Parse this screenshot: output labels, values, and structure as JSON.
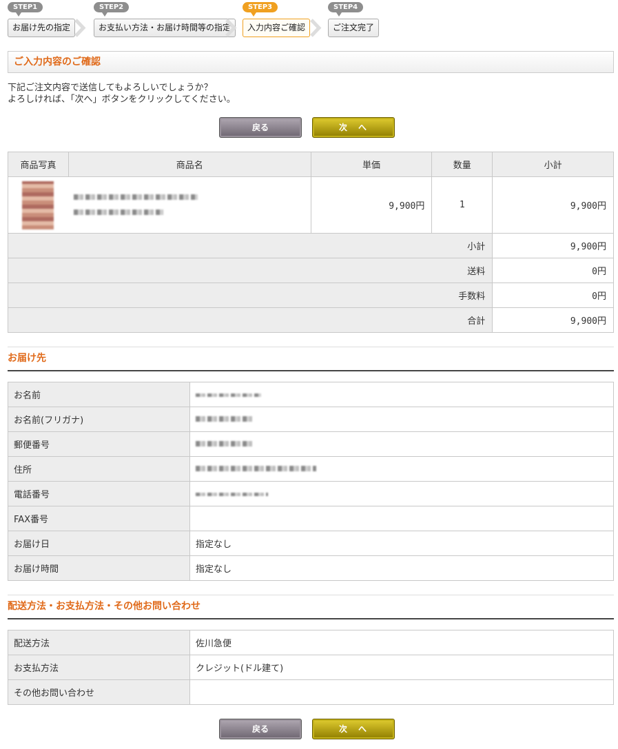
{
  "steps": [
    {
      "badge": "STEP1",
      "label": "お届け先の指定"
    },
    {
      "badge": "STEP2",
      "label": "お支払い方法・お届け時間等の指定"
    },
    {
      "badge": "STEP3",
      "label": "入力内容ご確認"
    },
    {
      "badge": "STEP4",
      "label": "ご注文完了"
    }
  ],
  "section_title": "ご入力内容のご確認",
  "intro": {
    "line1": "下記ご注文内容で送信してもよろしいでしょうか？",
    "line2": "よろしければ、「次へ」ボタンをクリックしてください。"
  },
  "buttons": {
    "back": "戻る",
    "next": "次　へ"
  },
  "order_table": {
    "headers": [
      "商品写真",
      "商品名",
      "単価",
      "数量",
      "小計"
    ],
    "item": {
      "unit_price": "9,900円",
      "quantity": "1",
      "subtotal": "9,900円"
    },
    "summary": [
      {
        "label": "小計",
        "value": "9,900円"
      },
      {
        "label": "送料",
        "value": "0円"
      },
      {
        "label": "手数料",
        "value": "0円"
      },
      {
        "label": "合計",
        "value": "9,900円"
      }
    ]
  },
  "delivery": {
    "title": "お届け先",
    "rows": [
      {
        "label": "お名前",
        "value": ""
      },
      {
        "label": "お名前(フリガナ)",
        "value": ""
      },
      {
        "label": "郵便番号",
        "value": ""
      },
      {
        "label": "住所",
        "value": ""
      },
      {
        "label": "電話番号",
        "value": ""
      },
      {
        "label": "FAX番号",
        "value": ""
      },
      {
        "label": "お届け日",
        "value": "指定なし"
      },
      {
        "label": "お届け時間",
        "value": "指定なし"
      }
    ]
  },
  "shipping": {
    "title": "配送方法・お支払方法・その他お問い合わせ",
    "rows": [
      {
        "label": "配送方法",
        "value": "佐川急便"
      },
      {
        "label": "お支払方法",
        "value": "クレジット(ドル建て)"
      },
      {
        "label": "その他お問い合わせ",
        "value": ""
      }
    ]
  }
}
